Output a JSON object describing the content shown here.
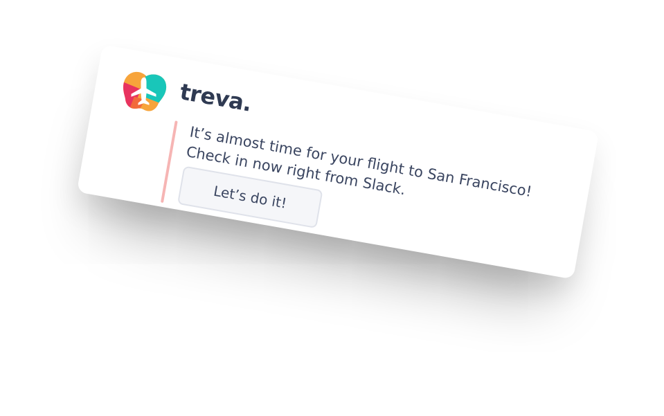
{
  "app": {
    "name": "treva.",
    "logo_icon": "plane-globe-icon"
  },
  "notification": {
    "line1": "It’s almost time for your flight to San Francisco!",
    "line2": "Check in now right from Slack.",
    "button_label": "Let’s do it!"
  },
  "colors": {
    "accent_bar": "#f6b5b4",
    "text": "#3a4560",
    "brand_text": "#2f3a52",
    "logo_orange": "#f7a43b",
    "logo_teal": "#19c6b9",
    "logo_pink": "#e8335f"
  }
}
